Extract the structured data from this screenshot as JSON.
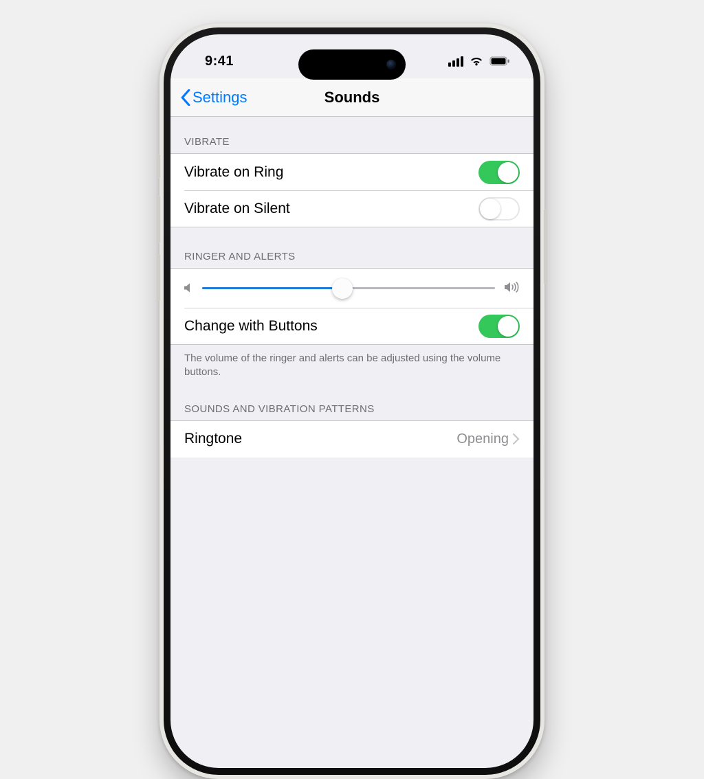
{
  "status_bar": {
    "time": "9:41"
  },
  "nav": {
    "back_label": "Settings",
    "title": "Sounds"
  },
  "sections": {
    "vibrate": {
      "header": "VIBRATE",
      "vibrate_on_ring": {
        "label": "Vibrate on Ring",
        "on": true
      },
      "vibrate_on_silent": {
        "label": "Vibrate on Silent",
        "on": false
      }
    },
    "ringer": {
      "header": "RINGER AND ALERTS",
      "volume_percent": 48,
      "change_with_buttons": {
        "label": "Change with Buttons",
        "on": true
      },
      "footer": "The volume of the ringer and alerts can be adjusted using the volume buttons."
    },
    "patterns": {
      "header": "SOUNDS AND VIBRATION PATTERNS",
      "ringtone": {
        "label": "Ringtone",
        "value": "Opening"
      }
    }
  }
}
